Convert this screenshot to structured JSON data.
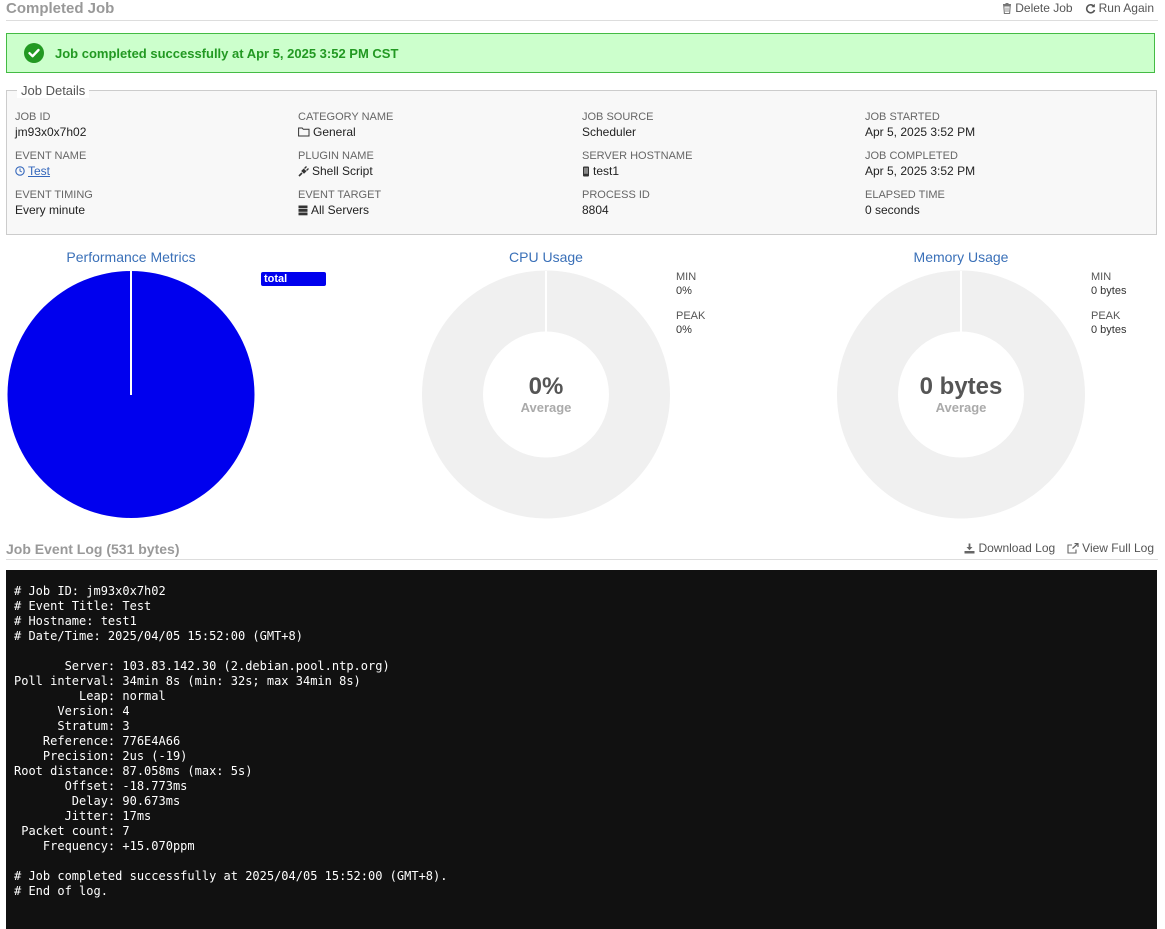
{
  "header": {
    "title": "Completed Job",
    "delete_label": "Delete Job",
    "run_again_label": "Run Again"
  },
  "banner": {
    "message": "Job completed successfully at Apr 5, 2025 3:52 PM CST"
  },
  "details": {
    "legend": "Job Details",
    "job_id": {
      "label": "JOB ID",
      "value": "jm93x0x7h02"
    },
    "event_name": {
      "label": "EVENT NAME",
      "value": "Test"
    },
    "event_timing": {
      "label": "EVENT TIMING",
      "value": "Every minute"
    },
    "category_name": {
      "label": "CATEGORY NAME",
      "value": "General"
    },
    "plugin_name": {
      "label": "PLUGIN NAME",
      "value": "Shell Script"
    },
    "event_target": {
      "label": "EVENT TARGET",
      "value": "All Servers"
    },
    "job_source": {
      "label": "JOB SOURCE",
      "value": "Scheduler"
    },
    "server_hostname": {
      "label": "SERVER HOSTNAME",
      "value": "test1"
    },
    "process_id": {
      "label": "PROCESS ID",
      "value": "8804"
    },
    "job_started": {
      "label": "JOB STARTED",
      "value": "Apr 5, 2025 3:52 PM"
    },
    "job_completed": {
      "label": "JOB COMPLETED",
      "value": "Apr 5, 2025 3:52 PM"
    },
    "elapsed_time": {
      "label": "ELAPSED TIME",
      "value": "0 seconds"
    }
  },
  "performance": {
    "title": "Performance Metrics",
    "legend_label": "total"
  },
  "cpu": {
    "title": "CPU Usage",
    "min_label": "MIN",
    "min_value": "0%",
    "peak_label": "PEAK",
    "peak_value": "0%",
    "center_value": "0%",
    "center_label": "Average"
  },
  "memory": {
    "title": "Memory Usage",
    "min_label": "MIN",
    "min_value": "0 bytes",
    "peak_label": "PEAK",
    "peak_value": "0 bytes",
    "center_value": "0 bytes",
    "center_label": "Average"
  },
  "log": {
    "title": "Job Event Log (531 bytes)",
    "download_label": "Download Log",
    "view_full_label": "View Full Log",
    "content": "# Job ID: jm93x0x7h02\n# Event Title: Test\n# Hostname: test1\n# Date/Time: 2025/04/05 15:52:00 (GMT+8)\n\n       Server: 103.83.142.30 (2.debian.pool.ntp.org)\nPoll interval: 34min 8s (min: 32s; max 34min 8s)\n         Leap: normal\n      Version: 4\n      Stratum: 3\n    Reference: 776E4A66\n    Precision: 2us (-19)\nRoot distance: 87.058ms (max: 5s)\n       Offset: -18.773ms\n        Delay: 90.673ms\n       Jitter: 17ms\n Packet count: 7\n    Frequency: +15.070ppm\n\n# Job completed successfully at 2025/04/05 15:52:00 (GMT+8).\n# End of log."
  },
  "colors": {
    "success_bg": "#ccffcc",
    "success_text": "#229922",
    "link_blue": "#3a70b8",
    "pie_blue": "#0000ee",
    "donut_gray": "#f0f0f0",
    "log_bg": "#111111"
  },
  "icons": [
    "trash-icon",
    "refresh-icon",
    "check-circle-icon",
    "clock-icon",
    "folder-icon",
    "plug-icon",
    "mobile-icon",
    "server-icon",
    "download-icon",
    "external-link-icon"
  ]
}
